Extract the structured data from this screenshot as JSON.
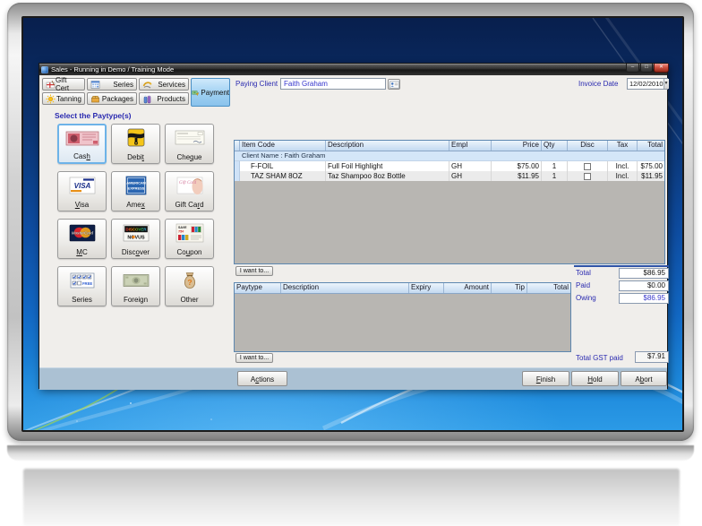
{
  "window": {
    "title": "Sales - Running in Demo / Training Mode",
    "controls": {
      "minimize": "–",
      "maximize": "□",
      "close": "✕"
    }
  },
  "toolbar": {
    "buttons": [
      {
        "label": "Gift Cert"
      },
      {
        "label": "Series"
      },
      {
        "label": "Services"
      },
      {
        "label": "Tanning"
      },
      {
        "label": "Packages"
      },
      {
        "label": "Products"
      },
      {
        "label": "Payment",
        "active": true
      }
    ]
  },
  "client": {
    "label": "Paying Client",
    "value": "Faith Graham"
  },
  "invoice_date": {
    "label": "Invoice Date",
    "value": "12/02/2010",
    "dropdown_glyph": "▼"
  },
  "paytype_section": {
    "heading": "Select the Paytype(s)",
    "buttons": [
      {
        "label": "Cash",
        "mnemonic": "h",
        "selected": true
      },
      {
        "label": "Debit",
        "mnemonic": "t"
      },
      {
        "label": "Cheque",
        "mnemonic": "q"
      },
      {
        "label": "Visa",
        "mnemonic": "V"
      },
      {
        "label": "Amex",
        "mnemonic": "x"
      },
      {
        "label": "Gift Card",
        "mnemonic": "r"
      },
      {
        "label": "MC",
        "mnemonic": "M"
      },
      {
        "label": "Discover",
        "mnemonic": "o"
      },
      {
        "label": "Coupon",
        "mnemonic": "u"
      },
      {
        "label": "Series"
      },
      {
        "label": "Foreign"
      },
      {
        "label": "Other"
      }
    ]
  },
  "card_art": {
    "visa": "VISA",
    "amex1": "AMERICAN",
    "amex2": "EXPRESS",
    "mastercard": "MasterCard",
    "discover": "DISCOVER",
    "novus": "NOVUS",
    "free": "FREE",
    "save": "SAVE",
    "save_amt": "75¢",
    "gift_script": "Gift Card",
    "other_mark": "?"
  },
  "items_table": {
    "columns": [
      "Item Code",
      "Description",
      "Empl",
      "Price",
      "Qty",
      "Disc",
      "Tax",
      "Total"
    ],
    "group_header": "Client Name : Faith Graham",
    "rows": [
      {
        "code": "F-FOIL",
        "desc": "Full Foil Highlight",
        "empl": "GH",
        "price": "$75.00",
        "qty": "1",
        "tax": "Incl.",
        "total": "$75.00"
      },
      {
        "code": "TAZ SHAM 8OZ",
        "desc": "Taz Shampoo 8oz Bottle",
        "empl": "GH",
        "price": "$11.95",
        "qty": "1",
        "tax": "Incl.",
        "total": "$11.95"
      }
    ]
  },
  "payments_table": {
    "columns": [
      "Paytype",
      "Description",
      "Expiry",
      "Amount",
      "Tip",
      "Total"
    ]
  },
  "actions_menu": {
    "i_want_to": "I want to..."
  },
  "totals": {
    "total_label": "Total",
    "total_value": "$86.95",
    "paid_label": "Paid",
    "paid_value": "$0.00",
    "owing_label": "Owing",
    "owing_value": "$86.95",
    "gst_label": "Total GST paid",
    "gst_value": "$7.91"
  },
  "footer": {
    "actions": {
      "label": "Actions",
      "mnemonic": "c"
    },
    "finish": {
      "label": "Finish",
      "mnemonic": "F"
    },
    "hold": {
      "label": "Hold",
      "mnemonic": "H"
    },
    "abort": {
      "label": "Abort",
      "mnemonic": "b"
    }
  },
  "colors": {
    "label_blue": "#2a2ab0",
    "value_blue": "#3333cc",
    "selected_paytype_border": "#6db3e8",
    "payment_button_active": "#9fd0f2",
    "close_button_red": "#c0392b",
    "table_header_blue": "#c3d9f1"
  }
}
